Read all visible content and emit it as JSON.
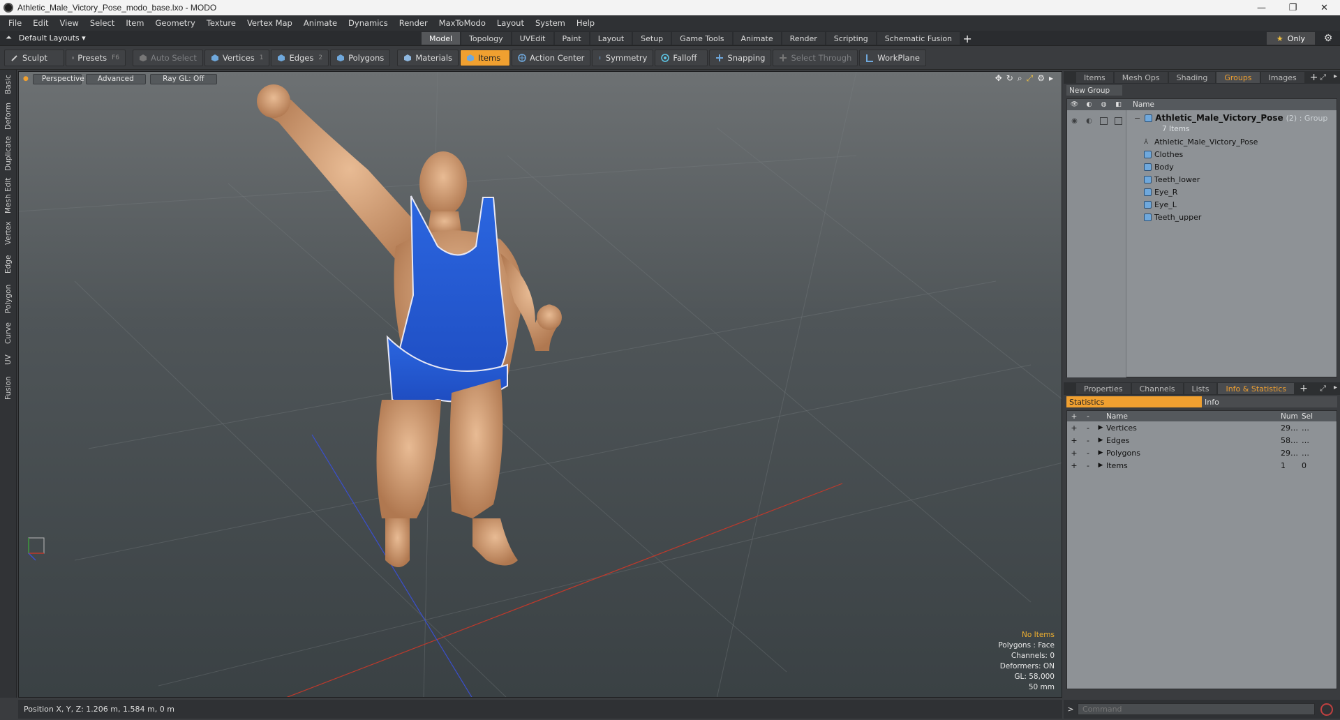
{
  "window": {
    "title": "Athletic_Male_Victory_Pose_modo_base.lxo - MODO",
    "minimize": "—",
    "maximize": "❐",
    "close": "✕"
  },
  "menu": [
    "File",
    "Edit",
    "View",
    "Select",
    "Item",
    "Geometry",
    "Texture",
    "Vertex Map",
    "Animate",
    "Dynamics",
    "Render",
    "MaxToModo",
    "Layout",
    "System",
    "Help"
  ],
  "layoutbar": {
    "layout_name": "Default Layouts ▾",
    "tabs": [
      "Model",
      "Topology",
      "UVEdit",
      "Paint",
      "Layout",
      "Setup",
      "Game Tools",
      "Animate",
      "Render",
      "Scripting",
      "Schematic Fusion"
    ],
    "active_tab": "Model",
    "only_label": "Only"
  },
  "toolbar": {
    "sculpt": "Sculpt",
    "presets": "Presets",
    "presets_key": "F6",
    "auto_select": "Auto Select",
    "vertices": "Vertices",
    "vertices_count": "1",
    "edges": "Edges",
    "edges_count": "2",
    "polygons": "Polygons",
    "materials": "Materials",
    "items": "Items",
    "action_center": "Action Center",
    "symmetry": "Symmetry",
    "falloff": "Falloff",
    "snapping": "Snapping",
    "select_through": "Select Through",
    "workplane": "WorkPlane"
  },
  "left_tabs": [
    "Basic",
    "Deform",
    "Duplicate",
    "Mesh Edit",
    "Vertex",
    "Edge",
    "Polygon",
    "Curve",
    "UV",
    "Fusion"
  ],
  "viewport": {
    "view": "Perspective",
    "shading": "Advanced",
    "raygl": "Ray GL: Off",
    "info": {
      "no_items": "No Items",
      "polygons": "Polygons : Face",
      "channels": "Channels: 0",
      "deformers": "Deformers: ON",
      "gl": "GL: 58,000",
      "size": "50 mm"
    }
  },
  "status": {
    "position": "Position X, Y, Z:   1.206 m, 1.584 m, 0 m"
  },
  "groups_panel": {
    "tabs": [
      "Items",
      "Mesh Ops",
      "Shading",
      "Groups",
      "Images"
    ],
    "active_tab": "Groups",
    "new_group": "New Group",
    "col_name": "Name",
    "group_name": "Athletic_Male_Victory_Pose",
    "group_meta": "(2) : Group",
    "group_count": "7 Items",
    "children": [
      "Athletic_Male_Victory_Pose",
      "Clothes",
      "Body",
      "Teeth_lower",
      "Eye_R",
      "Eye_L",
      "Teeth_upper"
    ]
  },
  "props_panel": {
    "tabs": [
      "Properties",
      "Channels",
      "Lists",
      "Info & Statistics"
    ],
    "active_tab": "Info & Statistics",
    "subtabs": [
      "Statistics",
      "Info"
    ],
    "active_subtab": "Statistics",
    "columns": {
      "name": "Name",
      "num": "Num",
      "sel": "Sel"
    },
    "rows": [
      {
        "name": "Vertices",
        "num": "29…",
        "sel": "…"
      },
      {
        "name": "Edges",
        "num": "58…",
        "sel": "…"
      },
      {
        "name": "Polygons",
        "num": "29…",
        "sel": "…"
      },
      {
        "name": "Items",
        "num": "1",
        "sel": "0"
      }
    ]
  },
  "command": {
    "placeholder": "Command"
  },
  "colors": {
    "accent": "#f0a030",
    "viewport_top": "#6d7173",
    "viewport_bottom": "#3a4144"
  }
}
